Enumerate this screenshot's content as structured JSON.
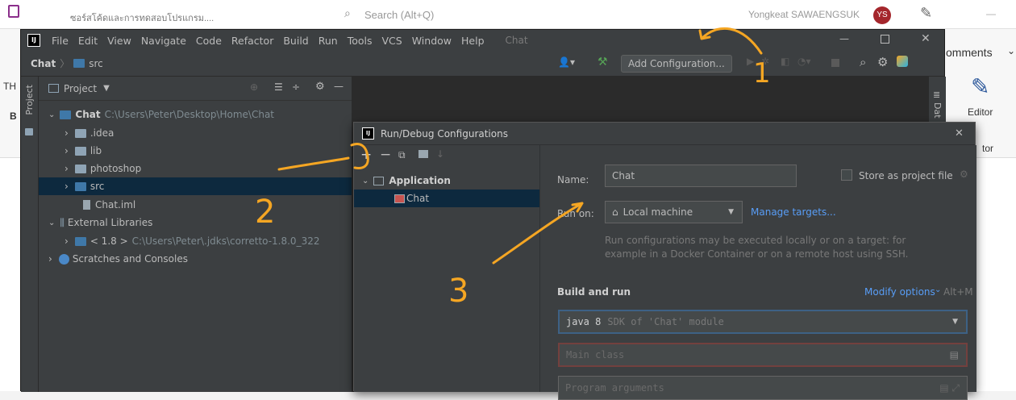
{
  "word": {
    "doc_title": "ซอร์สโค้ดและการทดสอบโปรแกรม....",
    "search_placeholder": "Search (Alt+Q)",
    "user_name": "Yongkeat SAWAENGSUK",
    "avatar_initials": "YS",
    "comments_label": "omments",
    "editor_label": "Editor",
    "tor_label": "tor",
    "th_label": "TH",
    "b_label": "B"
  },
  "ide": {
    "menu": [
      "File",
      "Edit",
      "View",
      "Navigate",
      "Code",
      "Refactor",
      "Build",
      "Run",
      "Tools",
      "VCS",
      "Window",
      "Help"
    ],
    "window_title": "Chat",
    "breadcrumb": [
      "Chat",
      "src"
    ],
    "add_config_label": "Add Configuration...",
    "side_tab": "Project",
    "right_tab": "Dat",
    "project_dropdown": "Project",
    "tree": [
      {
        "label": "Chat",
        "path": "C:\\Users\\Peter\\Desktop\\Home\\Chat"
      },
      {
        "label": ".idea"
      },
      {
        "label": "lib"
      },
      {
        "label": "photoshop"
      },
      {
        "label": "src"
      },
      {
        "label": "Chat.iml"
      },
      {
        "label": "External Libraries"
      },
      {
        "label": "< 1.8 >",
        "path": "C:\\Users\\Peter\\.jdks\\corretto-1.8.0_322"
      },
      {
        "label": "Scratches and Consoles"
      }
    ]
  },
  "dialog": {
    "title": "Run/Debug Configurations",
    "tree": [
      {
        "label": "Application"
      },
      {
        "label": "Chat"
      }
    ],
    "name_label": "Name:",
    "name_value": "Chat",
    "store_label": "Store as project file",
    "run_on_label": "Run on:",
    "run_on_value": "Local machine",
    "manage_targets": "Manage targets...",
    "run_hint_1": "Run configurations may be executed locally or on a target: for",
    "run_hint_2": "example in a Docker Container or on a remote host using SSH.",
    "build_run_label": "Build and run",
    "modify_options": "Modify options",
    "modify_shortcut": "Alt+M",
    "sdk_value": "java 8",
    "sdk_hint": "SDK of 'Chat' module",
    "main_class_placeholder": "Main class",
    "program_args_placeholder": "Program arguments"
  },
  "annotations": [
    "1",
    "2",
    "3"
  ],
  "colors": {
    "annotation": "#f5a623",
    "link": "#589df6",
    "selection": "#0d293e"
  }
}
